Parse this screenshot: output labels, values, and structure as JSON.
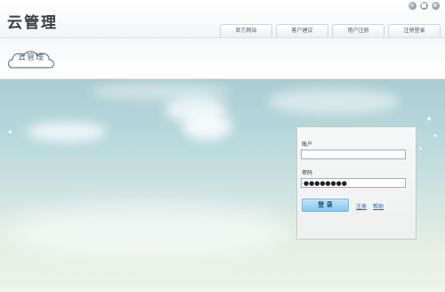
{
  "app": {
    "title": "云管理",
    "logo_text": "云管理"
  },
  "window_controls": [
    {
      "name": "minimize-icon",
      "glyph": "‹"
    },
    {
      "name": "restore-icon",
      "glyph": "■"
    },
    {
      "name": "close-icon",
      "glyph": "✕"
    }
  ],
  "nav": {
    "tabs": [
      "官方网站",
      "客户建议",
      "用户注册",
      "注销登录"
    ]
  },
  "login": {
    "account_label": "账户",
    "account_value": "",
    "password_label": "密码",
    "password_value": "●●●●●●●●",
    "login_button": "登 录",
    "register_link": "注册",
    "help_link": "帮助"
  },
  "colors": {
    "accent": "#89c9ef",
    "link": "#2a67b5",
    "sky": "#b9d9dc"
  }
}
